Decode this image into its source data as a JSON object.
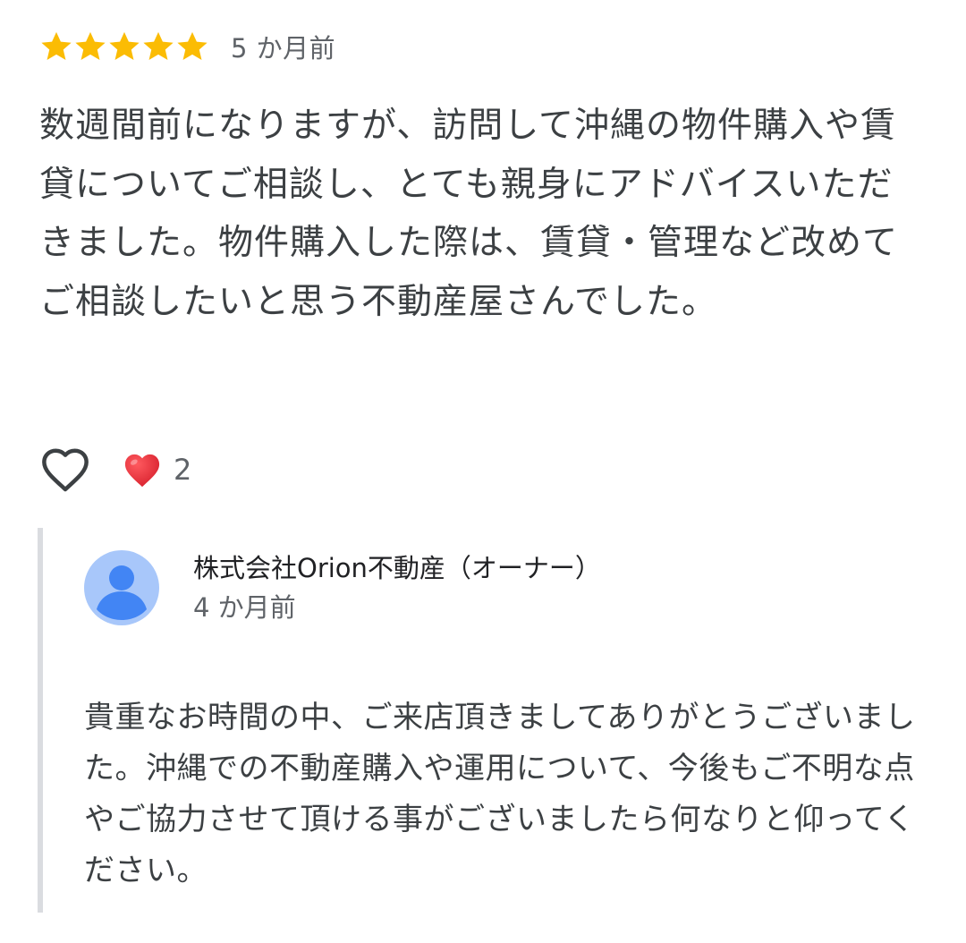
{
  "review": {
    "rating": 5,
    "max_rating": 5,
    "star_color": "#fbbc04",
    "date": "5 か月前",
    "text": "数週間前になりますが、訪問して沖縄の物件購入や賃貸についてご相談し、とても親身にアドバイスいただきました。物件購入した際は、賃貸・管理など改めてご相談したいと思う不動産屋さんでした。"
  },
  "actions": {
    "like_icon": "heart-outline-icon",
    "reaction_icon": "red-heart-emoji",
    "reaction_count": "2"
  },
  "owner_reply": {
    "author": "株式会社Orion不動産（オーナー）",
    "date": "4 か月前",
    "avatar_icon": "default-person-avatar",
    "avatar_bg": "#a8c7fa",
    "avatar_fg": "#4285f4",
    "text": "貴重なお時間の中、ご来店頂きましてありがとうございました。沖縄での不動産購入や運用について、今後もご不明な点やご協力させて頂ける事がございましたら何なりと仰ってください。"
  }
}
